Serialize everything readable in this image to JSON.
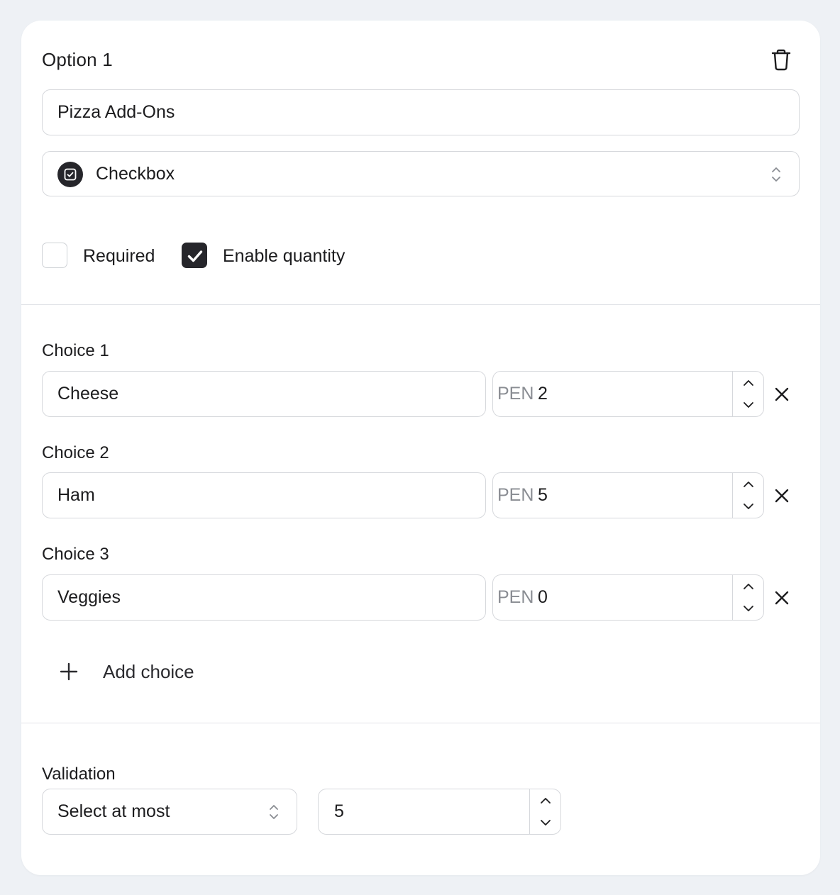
{
  "option": {
    "title": "Option 1",
    "name_value": "Pizza Add-Ons",
    "type_value": "Checkbox",
    "required_label": "Required",
    "required_checked": false,
    "quantity_label": "Enable quantity",
    "quantity_checked": true
  },
  "choices": [
    {
      "label": "Choice 1",
      "name": "Cheese",
      "currency": "PEN",
      "price": "2"
    },
    {
      "label": "Choice 2",
      "name": "Ham",
      "currency": "PEN",
      "price": "5"
    },
    {
      "label": "Choice 3",
      "name": "Veggies",
      "currency": "PEN",
      "price": "0"
    }
  ],
  "add_choice_label": "Add choice",
  "validation": {
    "label": "Validation",
    "rule_value": "Select at most",
    "count_value": "5"
  },
  "icons": {
    "delete": "trash-icon",
    "type": "checkbox-square-icon",
    "select": "chevron-up-down-icon",
    "check": "checkmark-icon",
    "remove": "close-icon",
    "add": "plus-icon",
    "step_up": "chevron-up-icon",
    "step_down": "chevron-down-icon"
  },
  "colors": {
    "background": "#eef1f5",
    "card": "#ffffff",
    "border": "#d6d8dc",
    "checked": "#26262b",
    "muted_text": "#8a8d93"
  }
}
